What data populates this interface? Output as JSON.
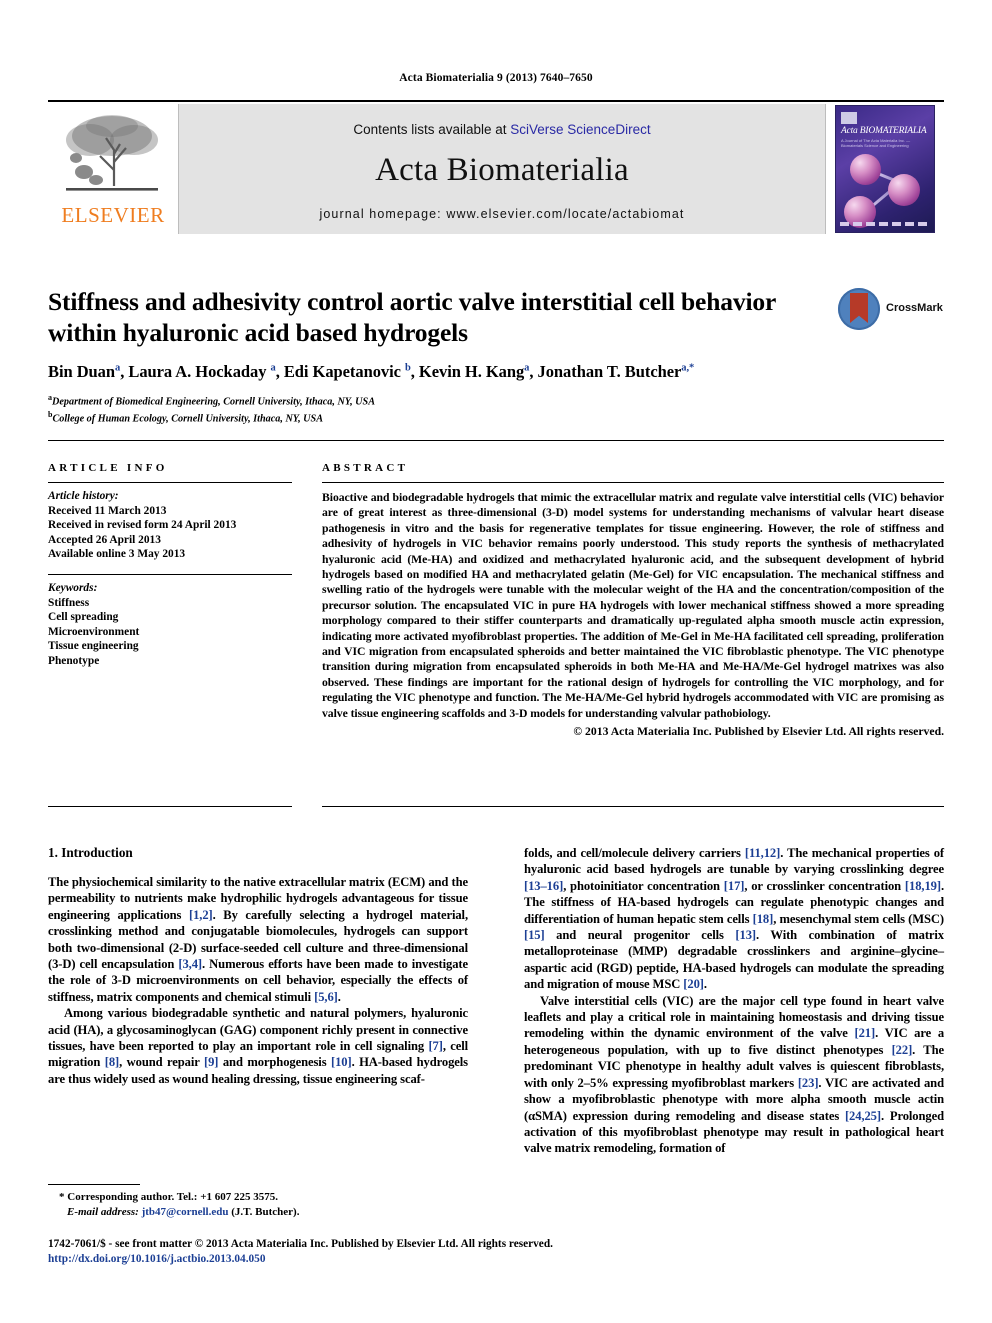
{
  "running_head": "Acta Biomaterialia 9 (2013) 7640–7650",
  "masthead": {
    "publisher_logo_label": "ELSEVIER",
    "contents_prefix": "Contents lists available at ",
    "contents_link": "SciVerse ScienceDirect",
    "journal_title": "Acta Biomaterialia",
    "homepage_line": "journal homepage: www.elsevier.com/locate/actabiomat",
    "cover": {
      "title": "Acta BIOMATERIALIA",
      "subtitle": "A Journal of The Acta Materialia Inc. — Biomaterials Science and Engineering"
    },
    "link_color": "#2a2aa5",
    "band_color": "#e3e3e3",
    "elsevier_orange": "#ef7d20"
  },
  "article": {
    "title": "Stiffness and adhesivity control aortic valve interstitial cell behavior within hyaluronic acid based hydrogels",
    "crossmark_label": "CrossMark",
    "authors_html": "Bin Duan<sup>a</sup>, Laura A. Hockaday <sup>a</sup>, Edi Kapetanovic <sup>b</sup>, Kevin H. Kang<sup>a</sup>, Jonathan T. Butcher<sup>a,*</sup>",
    "affiliations": [
      {
        "marker": "a",
        "text": "Department of Biomedical Engineering, Cornell University, Ithaca, NY, USA"
      },
      {
        "marker": "b",
        "text": "College of Human Ecology, Cornell University, Ithaca, NY, USA"
      }
    ]
  },
  "article_info": {
    "heading": "ARTICLE INFO",
    "history_label": "Article history:",
    "history": [
      "Received 11 March 2013",
      "Received in revised form 24 April 2013",
      "Accepted 26 April 2013",
      "Available online 3 May 2013"
    ],
    "keywords_label": "Keywords:",
    "keywords": [
      "Stiffness",
      "Cell spreading",
      "Microenvironment",
      "Tissue engineering",
      "Phenotype"
    ]
  },
  "abstract": {
    "heading": "ABSTRACT",
    "body": "Bioactive and biodegradable hydrogels that mimic the extracellular matrix and regulate valve interstitial cells (VIC) behavior are of great interest as three-dimensional (3-D) model systems for understanding mechanisms of valvular heart disease pathogenesis in vitro and the basis for regenerative templates for tissue engineering. However, the role of stiffness and adhesivity of hydrogels in VIC behavior remains poorly understood. This study reports the synthesis of methacrylated hyaluronic acid (Me-HA) and oxidized and methacrylated hyaluronic acid, and the subsequent development of hybrid hydrogels based on modified HA and methacrylated gelatin (Me-Gel) for VIC encapsulation. The mechanical stiffness and swelling ratio of the hydrogels were tunable with the molecular weight of the HA and the concentration/composition of the precursor solution. The encapsulated VIC in pure HA hydrogels with lower mechanical stiffness showed a more spreading morphology compared to their stiffer counterparts and dramatically up-regulated alpha smooth muscle actin expression, indicating more activated myofibroblast properties. The addition of Me-Gel in Me-HA facilitated cell spreading, proliferation and VIC migration from encapsulated spheroids and better maintained the VIC fibroblastic phenotype. The VIC phenotype transition during migration from encapsulated spheroids in both Me-HA and Me-HA/Me-Gel hydrogel matrixes was also observed. These findings are important for the rational design of hydrogels for controlling the VIC morphology, and for regulating the VIC phenotype and function. The Me-HA/Me-Gel hybrid hydrogels accommodated with VIC are promising as valve tissue engineering scaffolds and 3-D models for understanding valvular pathobiology.",
    "copyright": "© 2013 Acta Materialia Inc. Published by Elsevier Ltd. All rights reserved."
  },
  "body": {
    "section_title": "1. Introduction",
    "left_paragraphs_html": [
      "The physiochemical similarity to the native extracellular matrix (ECM) and the permeability to nutrients make hydrophilic hydrogels advantageous for tissue engineering applications <span class=\"ref\">[1,2]</span>. By carefully selecting a hydrogel material, crosslinking method and conjugatable biomolecules, hydrogels can support both two-dimensional (2-D) surface-seeded cell culture and three-dimensional (3-D) cell encapsulation <span class=\"ref\">[3,4]</span>. Numerous efforts have been made to investigate the role of 3-D microenvironments on cell behavior, especially the effects of stiffness, matrix components and chemical stimuli <span class=\"ref\">[5,6]</span>.",
      "Among various biodegradable synthetic and natural polymers, hyaluronic acid (HA), a glycosaminoglycan (GAG) component richly present in connective tissues, have been reported to play an important role in cell signaling <span class=\"ref\">[7]</span>, cell migration <span class=\"ref\">[8]</span>, wound repair <span class=\"ref\">[9]</span> and morphogenesis <span class=\"ref\">[10]</span>. HA-based hydrogels are thus widely used as wound healing dressing, tissue engineering scaf-"
    ],
    "right_paragraphs_html": [
      "folds, and cell/molecule delivery carriers <span class=\"ref\">[11,12]</span>. The mechanical properties of hyaluronic acid based hydrogels are tunable by varying crosslinking degree <span class=\"ref\">[13–16]</span>, photoinitiator concentration <span class=\"ref\">[17]</span>, or crosslinker concentration <span class=\"ref\">[18,19]</span>. The stiffness of HA-based hydrogels can regulate phenotypic changes and differentiation of human hepatic stem cells <span class=\"ref\">[18]</span>, mesenchymal stem cells (MSC) <span class=\"ref\">[15]</span> and neural progenitor cells <span class=\"ref\">[13]</span>. With combination of matrix metalloproteinase (MMP) degradable crosslinkers and arginine–glycine–aspartic acid (RGD) peptide, HA-based hydrogels can modulate the spreading and migration of mouse MSC <span class=\"ref\">[20]</span>.",
      "Valve interstitial cells (VIC) are the major cell type found in heart valve leaflets and play a critical role in maintaining homeostasis and driving tissue remodeling within the dynamic environment of the valve <span class=\"ref\">[21]</span>. VIC are a heterogeneous population, with up to five distinct phenotypes <span class=\"ref\">[22]</span>. The predominant VIC phenotype in healthy adult valves is quiescent fibroblasts, with only 2–5% expressing myofibroblast markers <span class=\"ref\">[23]</span>. VIC are activated and show a myofibroblastic phenotype with more alpha smooth muscle actin (αSMA) expression during remodeling and disease states <span class=\"ref\">[24,25]</span>. Prolonged activation of this myofibroblast phenotype may result in pathological heart valve matrix remodeling, formation of"
    ]
  },
  "footnote": {
    "marker": "*",
    "corresponding": "Corresponding author. Tel.: +1 607 225 3575.",
    "email_label": "E-mail address:",
    "email": "jtb47@cornell.edu",
    "email_owner": "(J.T. Butcher)."
  },
  "bottom": {
    "issn_line": "1742-7061/$ - see front matter © 2013 Acta Materialia Inc. Published by Elsevier Ltd. All rights reserved.",
    "doi": "http://dx.doi.org/10.1016/j.actbio.2013.04.050"
  }
}
